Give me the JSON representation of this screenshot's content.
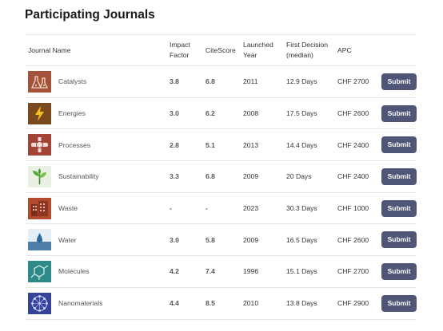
{
  "page": {
    "title": "Participating Journals"
  },
  "table": {
    "headers": {
      "journal": "Journal Name",
      "impact_1": "Impact",
      "impact_2": "Factor",
      "citescore": "CiteScore",
      "launched_1": "Launched",
      "launched_2": "Year",
      "decision_1": "First Decision",
      "decision_2": "(median)",
      "apc": "APC"
    },
    "rows": [
      {
        "name": "Catalysts",
        "impact": "3.8",
        "citescore": "6.8",
        "launched": "2011",
        "decision": "12.9 Days",
        "apc": "CHF 2700",
        "button": "Submit",
        "icon": "catalysts-flask-icon",
        "color": "#a4523a"
      },
      {
        "name": "Energies",
        "impact": "3.0",
        "citescore": "6.2",
        "launched": "2008",
        "decision": "17.5 Days",
        "apc": "CHF 2600",
        "button": "Submit",
        "icon": "energies-lightning-icon",
        "color": "#7a4a1e"
      },
      {
        "name": "Processes",
        "impact": "2.8",
        "citescore": "5.1",
        "launched": "2013",
        "decision": "14.4 Days",
        "apc": "CHF 2400",
        "button": "Submit",
        "icon": "processes-pipe-icon",
        "color": "#a14335"
      },
      {
        "name": "Sustainability",
        "impact": "3.3",
        "citescore": "6.8",
        "launched": "2009",
        "decision": "20 Days",
        "apc": "CHF 2400",
        "button": "Submit",
        "icon": "sustainability-plant-icon",
        "color": "#e8f1e4"
      },
      {
        "name": "Waste",
        "impact": "-",
        "citescore": "-",
        "launched": "2023",
        "decision": "30.3 Days",
        "apc": "CHF 1000",
        "button": "Submit",
        "icon": "waste-building-icon",
        "color": "#b24a2e"
      },
      {
        "name": "Water",
        "impact": "3.0",
        "citescore": "5.8",
        "launched": "2009",
        "decision": "16.5 Days",
        "apc": "CHF 2600",
        "button": "Submit",
        "icon": "water-drop-icon",
        "color": "#4d7fa8"
      },
      {
        "name": "Molecules",
        "impact": "4.2",
        "citescore": "7.4",
        "launched": "1996",
        "decision": "15.1 Days",
        "apc": "CHF 2700",
        "button": "Submit",
        "icon": "molecules-structure-icon",
        "color": "#2e8a86"
      },
      {
        "name": "Nanomaterials",
        "impact": "4.4",
        "citescore": "8.5",
        "launched": "2010",
        "decision": "13.8 Days",
        "apc": "CHF 2900",
        "button": "Submit",
        "icon": "nanomaterials-sphere-icon",
        "color": "#36439b"
      }
    ]
  },
  "colors": {
    "button_bg": "#4f5677",
    "button_text": "#ffffff",
    "border": "#e6e6e6"
  }
}
